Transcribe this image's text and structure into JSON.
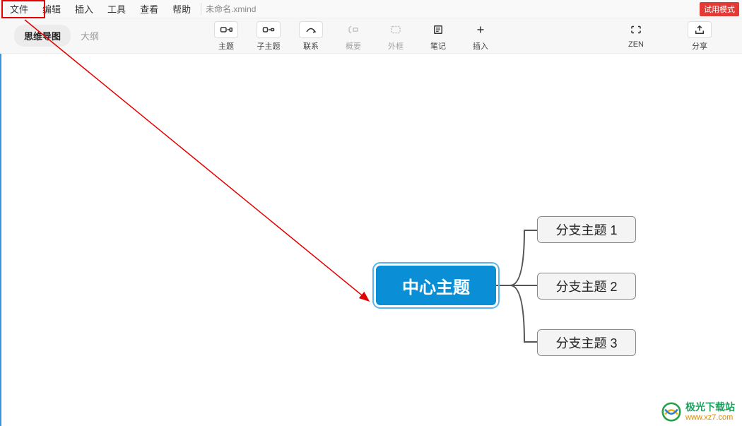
{
  "menubar": {
    "items": [
      "文件",
      "编辑",
      "插入",
      "工具",
      "查看",
      "帮助"
    ],
    "filename": "未命名.xmind"
  },
  "trial_badge": "试用模式",
  "view_tabs": {
    "mindmap": "思维导图",
    "outline": "大纲"
  },
  "toolbar": {
    "topic": "主题",
    "subtopic": "子主题",
    "relation": "联系",
    "summary": "概要",
    "boundary": "外框",
    "notes": "笔记",
    "insert": "插入",
    "zen": "ZEN",
    "share": "分享"
  },
  "mindmap": {
    "center": "中心主题",
    "branches": [
      "分支主题 1",
      "分支主题 2",
      "分支主题 3"
    ]
  },
  "watermark": {
    "title": "极光下载站",
    "url": "www.xz7.com"
  }
}
